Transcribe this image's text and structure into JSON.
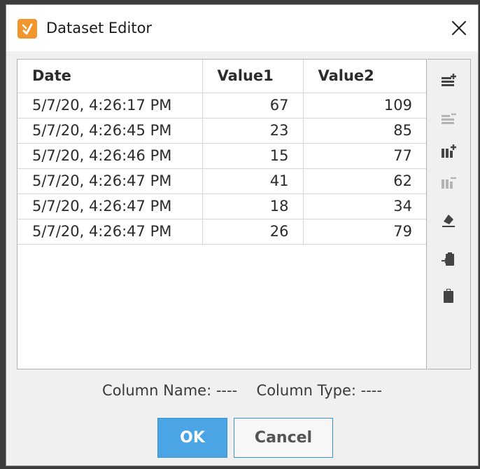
{
  "window": {
    "title": "Dataset Editor",
    "icon": "dataset-editor-app-icon",
    "close_icon": "close-icon",
    "accent_color": "#f0962c"
  },
  "table": {
    "columns": [
      "Date",
      "Value1",
      "Value2"
    ],
    "rows": [
      {
        "date": "5/7/20, 4:26:17 PM",
        "value1": "67",
        "value2": "109"
      },
      {
        "date": "5/7/20, 4:26:45 PM",
        "value1": "23",
        "value2": "85"
      },
      {
        "date": "5/7/20, 4:26:46 PM",
        "value1": "15",
        "value2": "77"
      },
      {
        "date": "5/7/20, 4:26:47 PM",
        "value1": "41",
        "value2": "62"
      },
      {
        "date": "5/7/20, 4:26:47 PM",
        "value1": "18",
        "value2": "34"
      },
      {
        "date": "5/7/20, 4:26:47 PM",
        "value1": "26",
        "value2": "79"
      }
    ]
  },
  "toolbar": {
    "buttons": [
      {
        "name": "add-row-icon",
        "enabled": true
      },
      {
        "name": "delete-row-icon",
        "enabled": false
      },
      {
        "name": "add-column-icon",
        "enabled": true
      },
      {
        "name": "delete-column-icon",
        "enabled": false
      },
      {
        "name": "clear-eraser-icon",
        "enabled": true
      },
      {
        "name": "paste-into-icon",
        "enabled": true
      },
      {
        "name": "clipboard-icon",
        "enabled": true
      }
    ]
  },
  "status": {
    "column_name_label": "Column Name:",
    "column_name_value": "----",
    "column_type_label": "Column Type:",
    "column_type_value": "----"
  },
  "buttons": {
    "ok_label": "OK",
    "cancel_label": "Cancel",
    "primary_color": "#4ba5e4"
  }
}
